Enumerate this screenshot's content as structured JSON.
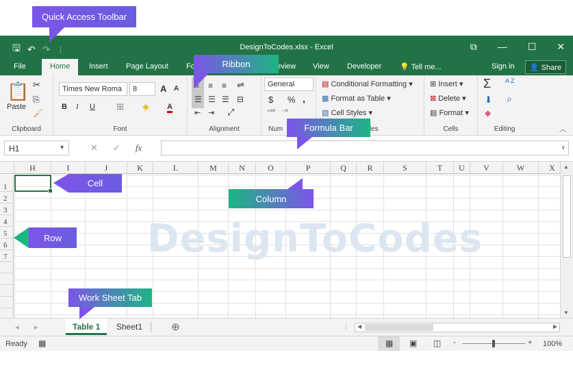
{
  "window": {
    "title": "DesignToCodes.xlsx - Excel",
    "controls": {
      "ribbon_display": "⧉",
      "minimize": "—",
      "maximize": "☐",
      "close": "✕"
    }
  },
  "qat": {
    "save": "🖫",
    "undo": "↶",
    "redo": "↷",
    "customize": "⋮"
  },
  "tabs": {
    "file": "File",
    "home": "Home",
    "insert": "Insert",
    "page_layout": "Page Layout",
    "formulas": "Fo",
    "review": "eview",
    "view": "View",
    "developer": "Developer",
    "tell_me": "Tell me...",
    "sign_in": "Sign in",
    "share": "Share"
  },
  "ribbon": {
    "clipboard": {
      "paste": "Paste",
      "label": "Clipboard"
    },
    "font": {
      "name": "Times New Roma",
      "size": "8",
      "grow": "A",
      "shrink": "A",
      "bold": "B",
      "italic": "I",
      "underline": "U",
      "font_color": "A",
      "label": "Font"
    },
    "alignment": {
      "label": "Alignment"
    },
    "number": {
      "format": "General",
      "currency": "$",
      "percent": "%",
      "comma": ",",
      "label": "Num"
    },
    "styles": {
      "conditional": "Conditional Formatting",
      "format_table": "Format as Table",
      "cell_styles": "Cell Styles",
      "label": "les"
    },
    "cells": {
      "insert": "Insert",
      "delete": "Delete",
      "format": "Format",
      "label": "Cells"
    },
    "editing": {
      "sum": "Σ",
      "sort": "A Z",
      "find": "⌕",
      "label": "Editing"
    }
  },
  "formula_bar": {
    "name_box": "H1",
    "cancel": "✕",
    "enter": "✓",
    "fx": "fx",
    "value": ""
  },
  "grid": {
    "columns": [
      "H",
      "I",
      "J",
      "K",
      "L",
      "M",
      "N",
      "O",
      "P",
      "Q",
      "R",
      "S",
      "T",
      "U",
      "V",
      "W",
      "X"
    ],
    "rows": [
      "1",
      "2",
      "3",
      "4",
      "5",
      "6",
      "7",
      "",
      "",
      "",
      "",
      "",
      ""
    ],
    "selected": "H1"
  },
  "watermark": "DesignToCodes",
  "sheets": {
    "tabs": [
      "Table 1",
      "Sheet1"
    ],
    "active": "Table 1",
    "add": "⊕"
  },
  "status": {
    "ready": "Ready",
    "zoom": "100%",
    "minus": "-",
    "plus": "+"
  },
  "callouts": {
    "qat": "Quick Access Toolbar",
    "ribbon": "Ribbon",
    "formula_bar": "Formula Bar",
    "cell": "Cell",
    "column": "Column",
    "row": "Row",
    "worksheet_tab": "Work Sheet Tab"
  },
  "colors": {
    "excel_green": "#217346",
    "callout_purple": "#7c55e8",
    "callout_teal": "#1db584"
  },
  "zoom_level": 0.5
}
